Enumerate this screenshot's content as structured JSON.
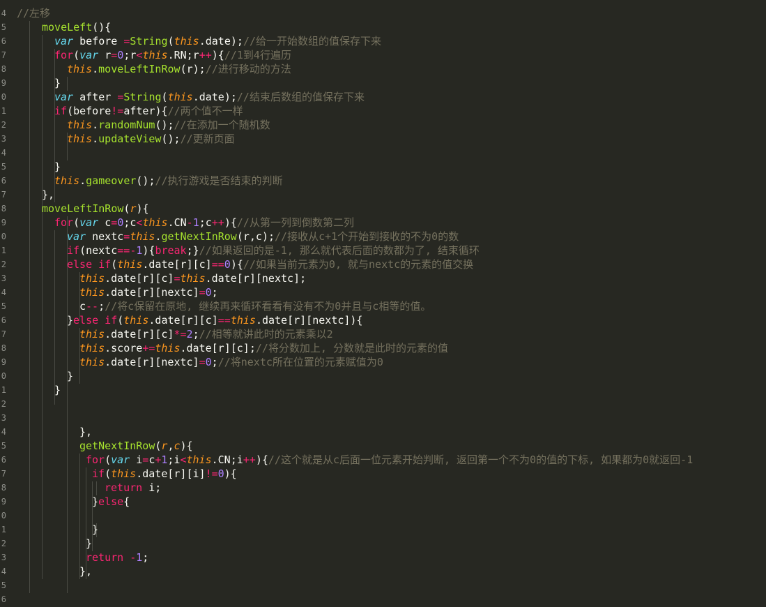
{
  "editor": {
    "language": "javascript",
    "theme_colors": {
      "background": "#272822",
      "comment": "#75715e",
      "keyword": "#f92672",
      "function": "#a6e22e",
      "number": "#ae81ff",
      "this": "#fd971f",
      "storage": "#66d9ef",
      "text": "#f8f8f2",
      "line_number": "#8f908a"
    },
    "line_numbers": [
      "4",
      "5",
      "6",
      "7",
      "8",
      "9",
      "0",
      "1",
      "2",
      "3",
      "4",
      "5",
      "6",
      "7",
      "8",
      "9",
      "0",
      "1",
      "2",
      "3",
      "4",
      "5",
      "6",
      "7",
      "8",
      "9",
      "0",
      "1",
      "2",
      "3",
      "4",
      "5",
      "6",
      "7",
      "8",
      "9",
      "0",
      "1",
      "2",
      "3",
      "4",
      "5",
      "6"
    ],
    "lines": [
      [
        [
          "c",
          "//左移"
        ]
      ],
      [
        [
          "fn",
          "moveLeft"
        ],
        [
          "pl",
          "(){"
        ]
      ],
      [
        [
          "st",
          "var"
        ],
        [
          "pl",
          " before "
        ],
        [
          "op",
          "="
        ],
        [
          "fn",
          "String"
        ],
        [
          "pl",
          "("
        ],
        [
          "th",
          "this"
        ],
        [
          "pl",
          ".date);"
        ],
        [
          "c",
          "//给一开始数组的值保存下来"
        ]
      ],
      [
        [
          "kw",
          "for"
        ],
        [
          "pl",
          "("
        ],
        [
          "st",
          "var"
        ],
        [
          "pl",
          " r"
        ],
        [
          "op",
          "="
        ],
        [
          "nm",
          "0"
        ],
        [
          "pl",
          ";r"
        ],
        [
          "op",
          "<"
        ],
        [
          "th",
          "this"
        ],
        [
          "pl",
          ".RN;r"
        ],
        [
          "op",
          "++"
        ],
        [
          "pl",
          "){"
        ],
        [
          "c",
          "//1到4行遍历"
        ]
      ],
      [
        [
          "th",
          "this"
        ],
        [
          "pl",
          "."
        ],
        [
          "fn",
          "moveLeftInRow"
        ],
        [
          "pl",
          "(r);"
        ],
        [
          "c",
          "//进行移动的方法"
        ]
      ],
      [
        [
          "pl",
          "}"
        ]
      ],
      [
        [
          "st",
          "var"
        ],
        [
          "pl",
          " after "
        ],
        [
          "op",
          "="
        ],
        [
          "fn",
          "String"
        ],
        [
          "pl",
          "("
        ],
        [
          "th",
          "this"
        ],
        [
          "pl",
          ".date);"
        ],
        [
          "c",
          "//结束后数组的值保存下来"
        ]
      ],
      [
        [
          "kw",
          "if"
        ],
        [
          "pl",
          "(before"
        ],
        [
          "op",
          "!="
        ],
        [
          "pl",
          "after){"
        ],
        [
          "c",
          "//两个值不一样"
        ]
      ],
      [
        [
          "th",
          "this"
        ],
        [
          "pl",
          "."
        ],
        [
          "fn",
          "randomNum"
        ],
        [
          "pl",
          "();"
        ],
        [
          "c",
          "//在添加一个随机数"
        ]
      ],
      [
        [
          "th",
          "this"
        ],
        [
          "pl",
          "."
        ],
        [
          "fn",
          "updateView"
        ],
        [
          "pl",
          "();"
        ],
        [
          "c",
          "//更新页面"
        ]
      ],
      [],
      [
        [
          "pl",
          "}"
        ]
      ],
      [
        [
          "th",
          "this"
        ],
        [
          "pl",
          "."
        ],
        [
          "fn",
          "gameover"
        ],
        [
          "pl",
          "();"
        ],
        [
          "c",
          "//执行游戏是否结束的判断"
        ]
      ],
      [
        [
          "pl",
          "},"
        ]
      ],
      [
        [
          "fn",
          "moveLeftInRow"
        ],
        [
          "pl",
          "("
        ],
        [
          "pr",
          "r"
        ],
        [
          "pl",
          "){"
        ]
      ],
      [
        [
          "kw",
          "for"
        ],
        [
          "pl",
          "("
        ],
        [
          "st",
          "var"
        ],
        [
          "pl",
          " c"
        ],
        [
          "op",
          "="
        ],
        [
          "nm",
          "0"
        ],
        [
          "pl",
          ";c"
        ],
        [
          "op",
          "<"
        ],
        [
          "th",
          "this"
        ],
        [
          "pl",
          ".CN"
        ],
        [
          "op",
          "-"
        ],
        [
          "nm",
          "1"
        ],
        [
          "pl",
          ";c"
        ],
        [
          "op",
          "++"
        ],
        [
          "pl",
          "){"
        ],
        [
          "c",
          "//从第一列到倒数第二列"
        ]
      ],
      [
        [
          "st",
          "var"
        ],
        [
          "pl",
          " nextc"
        ],
        [
          "op",
          "="
        ],
        [
          "th",
          "this"
        ],
        [
          "pl",
          "."
        ],
        [
          "fn",
          "getNextInRow"
        ],
        [
          "pl",
          "(r,c);"
        ],
        [
          "c",
          "//接收从c+1个开始到接收的不为0的数"
        ]
      ],
      [
        [
          "kw",
          "if"
        ],
        [
          "pl",
          "(nextc"
        ],
        [
          "op",
          "=="
        ],
        [
          "op",
          "-"
        ],
        [
          "nm",
          "1"
        ],
        [
          "pl",
          "){"
        ],
        [
          "kw",
          "break"
        ],
        [
          "pl",
          ";}"
        ],
        [
          "c",
          "//如果返回的是-1, 那么就代表后面的数都为了, 结束循环"
        ]
      ],
      [
        [
          "kw",
          "else if"
        ],
        [
          "pl",
          "("
        ],
        [
          "th",
          "this"
        ],
        [
          "pl",
          ".date[r][c]"
        ],
        [
          "op",
          "=="
        ],
        [
          "nm",
          "0"
        ],
        [
          "pl",
          "){"
        ],
        [
          "c",
          "//如果当前元素为0, 就与nextc的元素的值交换"
        ]
      ],
      [
        [
          "th",
          "this"
        ],
        [
          "pl",
          ".date[r][c]"
        ],
        [
          "op",
          "="
        ],
        [
          "th",
          "this"
        ],
        [
          "pl",
          ".date[r][nextc];"
        ]
      ],
      [
        [
          "th",
          "this"
        ],
        [
          "pl",
          ".date[r][nextc]"
        ],
        [
          "op",
          "="
        ],
        [
          "nm",
          "0"
        ],
        [
          "pl",
          ";"
        ]
      ],
      [
        [
          "pl",
          "c"
        ],
        [
          "op",
          "--"
        ],
        [
          "pl",
          ";"
        ],
        [
          "c",
          "//将c保留在原地, 继续再来循环看看有没有不为0并且与c相等的值。"
        ]
      ],
      [
        [
          "pl",
          "}"
        ],
        [
          "kw",
          "else if"
        ],
        [
          "pl",
          "("
        ],
        [
          "th",
          "this"
        ],
        [
          "pl",
          ".date[r][c]"
        ],
        [
          "op",
          "=="
        ],
        [
          "th",
          "this"
        ],
        [
          "pl",
          ".date[r][nextc]){"
        ]
      ],
      [
        [
          "th",
          "this"
        ],
        [
          "pl",
          ".date[r][c]"
        ],
        [
          "op",
          "*="
        ],
        [
          "nm",
          "2"
        ],
        [
          "pl",
          ";"
        ],
        [
          "c",
          "//相等就讲此时的元素乘以2"
        ]
      ],
      [
        [
          "th",
          "this"
        ],
        [
          "pl",
          ".score"
        ],
        [
          "op",
          "+="
        ],
        [
          "th",
          "this"
        ],
        [
          "pl",
          ".date[r][c];"
        ],
        [
          "c",
          "//将分数加上, 分数就是此时的元素的值"
        ]
      ],
      [
        [
          "th",
          "this"
        ],
        [
          "pl",
          ".date[r][nextc]"
        ],
        [
          "op",
          "="
        ],
        [
          "nm",
          "0"
        ],
        [
          "pl",
          ";"
        ],
        [
          "c",
          "//将nextc所在位置的元素赋值为0"
        ]
      ],
      [
        [
          "pl",
          "}"
        ]
      ],
      [
        [
          "pl",
          "}"
        ]
      ],
      [],
      [],
      [
        [
          "pl",
          "},"
        ]
      ],
      [
        [
          "fn",
          "getNextInRow"
        ],
        [
          "pl",
          "("
        ],
        [
          "pr",
          "r"
        ],
        [
          "pl",
          ","
        ],
        [
          "pr",
          "c"
        ],
        [
          "pl",
          "){"
        ]
      ],
      [
        [
          "kw",
          "for"
        ],
        [
          "pl",
          "("
        ],
        [
          "st",
          "var"
        ],
        [
          "pl",
          " i"
        ],
        [
          "op",
          "="
        ],
        [
          "pl",
          "c"
        ],
        [
          "op",
          "+"
        ],
        [
          "nm",
          "1"
        ],
        [
          "pl",
          ";i"
        ],
        [
          "op",
          "<"
        ],
        [
          "th",
          "this"
        ],
        [
          "pl",
          ".CN;i"
        ],
        [
          "op",
          "++"
        ],
        [
          "pl",
          "){"
        ],
        [
          "c",
          "//这个就是从c后面一位元素开始判断, 返回第一个不为0的值的下标, 如果都为0就返回-1"
        ]
      ],
      [
        [
          "kw",
          "if"
        ],
        [
          "pl",
          "("
        ],
        [
          "th",
          "this"
        ],
        [
          "pl",
          ".date[r][i]"
        ],
        [
          "op",
          "!="
        ],
        [
          "nm",
          "0"
        ],
        [
          "pl",
          "){"
        ]
      ],
      [
        [
          "kw",
          "return"
        ],
        [
          "pl",
          " i;"
        ]
      ],
      [
        [
          "pl",
          "}"
        ],
        [
          "kw",
          "else"
        ],
        [
          "pl",
          "{"
        ]
      ],
      [],
      [
        [
          "pl",
          "}"
        ]
      ],
      [
        [
          "pl",
          "}"
        ]
      ],
      [
        [
          "kw",
          "return"
        ],
        [
          "pl",
          " "
        ],
        [
          "op",
          "-"
        ],
        [
          "nm",
          "1"
        ],
        [
          "pl",
          ";"
        ]
      ],
      [
        [
          "pl",
          "},"
        ]
      ],
      [],
      []
    ]
  }
}
